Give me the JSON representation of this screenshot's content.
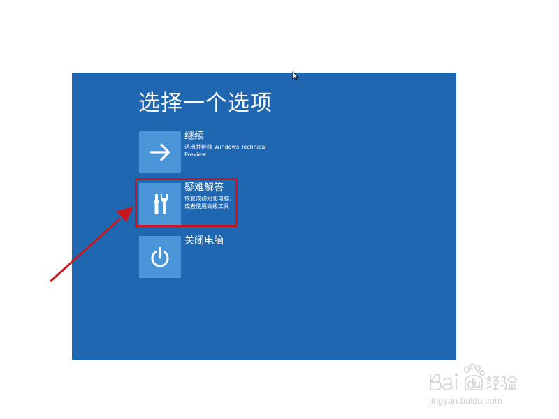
{
  "screen": {
    "title": "选择一个选项",
    "background_color": "#1f67b1",
    "tile_color": "#4b96d9"
  },
  "options": [
    {
      "label": "继续",
      "desc_lines": [
        "退出并继续 Windows Technical",
        "Preview"
      ],
      "icon": "arrow-right-icon"
    },
    {
      "label": "疑难解答",
      "desc_lines": [
        "恢复或初始化电脑，",
        "或者使用高级工具"
      ],
      "icon": "tools-icon"
    },
    {
      "label": "关闭电脑",
      "desc_lines": [],
      "icon": "power-icon"
    }
  ],
  "annotation": {
    "highlight_color": "#c8161d",
    "target": "疑难解答"
  },
  "watermark": {
    "logo_text": "Baidu经验",
    "url": "jingyan.baidu.com"
  }
}
